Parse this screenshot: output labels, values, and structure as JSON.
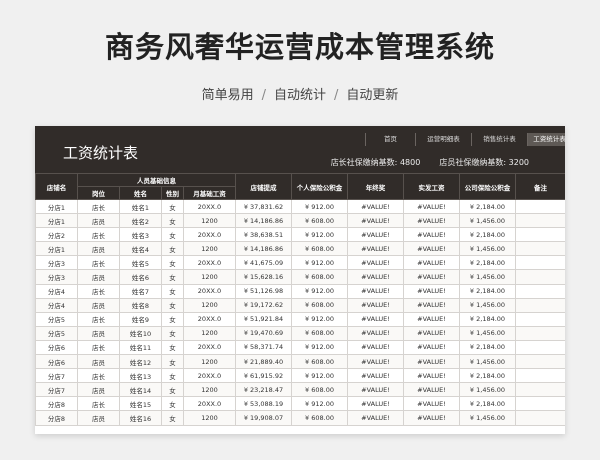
{
  "promo": {
    "title": "商务风奢华运营成本管理系统",
    "features": [
      "简单易用",
      "自动统计",
      "自动更新"
    ],
    "separator": "/"
  },
  "sheet": {
    "title": "工资统计表",
    "nav_tabs": [
      "首页",
      "运营明细表",
      "销售统计表",
      "工资统计表"
    ],
    "active_tab": "工资统计表",
    "manager_label": "店长社保缴纳基数:",
    "manager_value": "4800",
    "staff_label": "店员社保缴纳基数:",
    "staff_value": "3200"
  },
  "table": {
    "headers": {
      "store": "店铺名",
      "group": "人员基础信息",
      "position": "岗位",
      "name": "姓名",
      "gender": "性别",
      "base_salary": "月基础工资",
      "commission": "店铺提成",
      "personal_fund": "个人保险公积金",
      "bonus": "年终奖",
      "actual_salary": "实发工资",
      "company_fund": "公司保险公积金",
      "note": "备注"
    },
    "rows": [
      [
        "分店1",
        "店长",
        "姓名1",
        "女",
        "20XX.0",
        "¥ 37,831.62",
        "¥ 912.00",
        "#VALUE!",
        "#VALUE!",
        "¥ 2,184.00",
        ""
      ],
      [
        "分店1",
        "店员",
        "姓名2",
        "女",
        "1200",
        "¥ 14,186.86",
        "¥ 608.00",
        "#VALUE!",
        "#VALUE!",
        "¥ 1,456.00",
        ""
      ],
      [
        "分店2",
        "店长",
        "姓名3",
        "女",
        "20XX.0",
        "¥ 38,638.51",
        "¥ 912.00",
        "#VALUE!",
        "#VALUE!",
        "¥ 2,184.00",
        ""
      ],
      [
        "分店1",
        "店员",
        "姓名4",
        "女",
        "1200",
        "¥ 14,186.86",
        "¥ 608.00",
        "#VALUE!",
        "#VALUE!",
        "¥ 1,456.00",
        ""
      ],
      [
        "分店3",
        "店长",
        "姓名5",
        "女",
        "20XX.0",
        "¥ 41,675.09",
        "¥ 912.00",
        "#VALUE!",
        "#VALUE!",
        "¥ 2,184.00",
        ""
      ],
      [
        "分店3",
        "店员",
        "姓名6",
        "女",
        "1200",
        "¥ 15,628.16",
        "¥ 608.00",
        "#VALUE!",
        "#VALUE!",
        "¥ 1,456.00",
        ""
      ],
      [
        "分店4",
        "店长",
        "姓名7",
        "女",
        "20XX.0",
        "¥ 51,126.98",
        "¥ 912.00",
        "#VALUE!",
        "#VALUE!",
        "¥ 2,184.00",
        ""
      ],
      [
        "分店4",
        "店员",
        "姓名8",
        "女",
        "1200",
        "¥ 19,172.62",
        "¥ 608.00",
        "#VALUE!",
        "#VALUE!",
        "¥ 1,456.00",
        ""
      ],
      [
        "分店5",
        "店长",
        "姓名9",
        "女",
        "20XX.0",
        "¥ 51,921.84",
        "¥ 912.00",
        "#VALUE!",
        "#VALUE!",
        "¥ 2,184.00",
        ""
      ],
      [
        "分店5",
        "店员",
        "姓名10",
        "女",
        "1200",
        "¥ 19,470.69",
        "¥ 608.00",
        "#VALUE!",
        "#VALUE!",
        "¥ 1,456.00",
        ""
      ],
      [
        "分店6",
        "店长",
        "姓名11",
        "女",
        "20XX.0",
        "¥ 58,371.74",
        "¥ 912.00",
        "#VALUE!",
        "#VALUE!",
        "¥ 2,184.00",
        ""
      ],
      [
        "分店6",
        "店员",
        "姓名12",
        "女",
        "1200",
        "¥ 21,889.40",
        "¥ 608.00",
        "#VALUE!",
        "#VALUE!",
        "¥ 1,456.00",
        ""
      ],
      [
        "分店7",
        "店长",
        "姓名13",
        "女",
        "20XX.0",
        "¥ 61,915.92",
        "¥ 912.00",
        "#VALUE!",
        "#VALUE!",
        "¥ 2,184.00",
        ""
      ],
      [
        "分店7",
        "店员",
        "姓名14",
        "女",
        "1200",
        "¥ 23,218.47",
        "¥ 608.00",
        "#VALUE!",
        "#VALUE!",
        "¥ 1,456.00",
        ""
      ],
      [
        "分店8",
        "店长",
        "姓名15",
        "女",
        "20XX.0",
        "¥ 53,088.19",
        "¥ 912.00",
        "#VALUE!",
        "#VALUE!",
        "¥ 2,184.00",
        ""
      ],
      [
        "分店8",
        "店员",
        "姓名16",
        "女",
        "1200",
        "¥ 19,908.07",
        "¥ 608.00",
        "#VALUE!",
        "#VALUE!",
        "¥ 1,456.00",
        ""
      ]
    ]
  }
}
